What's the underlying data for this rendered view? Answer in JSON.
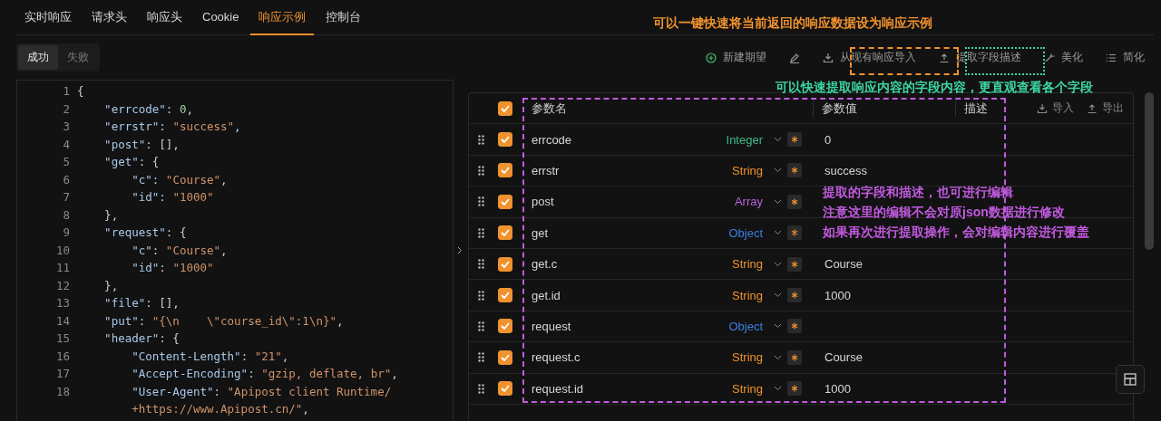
{
  "tabs": [
    {
      "label": "实时响应",
      "selected": false
    },
    {
      "label": "请求头",
      "selected": false
    },
    {
      "label": "响应头",
      "selected": false
    },
    {
      "label": "Cookie",
      "selected": false
    },
    {
      "label": "响应示例",
      "selected": true
    },
    {
      "label": "控制台",
      "selected": false
    }
  ],
  "result_toggle": [
    {
      "label": "成功",
      "selected": true
    },
    {
      "label": "失败",
      "selected": false
    }
  ],
  "toolbar": [
    {
      "kind": "new",
      "label": "新建期望"
    },
    {
      "kind": "edit"
    },
    {
      "kind": "import",
      "label": "从现有响应导入"
    },
    {
      "kind": "extract",
      "label": "提取字段描述"
    },
    {
      "kind": "beautify",
      "label": "美化"
    },
    {
      "kind": "simplify",
      "label": "简化"
    }
  ],
  "editor": {
    "lines": [
      {
        "number": "1",
        "tokens": [
          {
            "kind": "punct",
            "text": "{"
          }
        ]
      },
      {
        "number": "2",
        "tokens": [
          {
            "kind": "key",
            "text": "    \"errcode\""
          },
          {
            "kind": "punct",
            "text": ": "
          },
          {
            "kind": "num",
            "text": "0"
          },
          {
            "kind": "punct",
            "text": ","
          }
        ]
      },
      {
        "number": "3",
        "tokens": [
          {
            "kind": "key",
            "text": "    \"errstr\""
          },
          {
            "kind": "punct",
            "text": ": "
          },
          {
            "kind": "str",
            "text": "\"success\""
          },
          {
            "kind": "punct",
            "text": ","
          }
        ]
      },
      {
        "number": "4",
        "tokens": [
          {
            "kind": "key",
            "text": "    \"post\""
          },
          {
            "kind": "punct",
            "text": ": [],"
          }
        ]
      },
      {
        "number": "5",
        "tokens": [
          {
            "kind": "key",
            "text": "    \"get\""
          },
          {
            "kind": "punct",
            "text": ": {"
          }
        ]
      },
      {
        "number": "6",
        "tokens": [
          {
            "kind": "key",
            "text": "        \"c\""
          },
          {
            "kind": "punct",
            "text": ": "
          },
          {
            "kind": "str",
            "text": "\"Course\""
          },
          {
            "kind": "punct",
            "text": ","
          }
        ]
      },
      {
        "number": "7",
        "tokens": [
          {
            "kind": "key",
            "text": "        \"id\""
          },
          {
            "kind": "punct",
            "text": ": "
          },
          {
            "kind": "str",
            "text": "\"1000\""
          }
        ]
      },
      {
        "number": "8",
        "tokens": [
          {
            "kind": "punct",
            "text": "    },"
          }
        ]
      },
      {
        "number": "9",
        "tokens": [
          {
            "kind": "key",
            "text": "    \"request\""
          },
          {
            "kind": "punct",
            "text": ": {"
          }
        ]
      },
      {
        "number": "10",
        "tokens": [
          {
            "kind": "key",
            "text": "        \"c\""
          },
          {
            "kind": "punct",
            "text": ": "
          },
          {
            "kind": "str",
            "text": "\"Course\""
          },
          {
            "kind": "punct",
            "text": ","
          }
        ]
      },
      {
        "number": "11",
        "tokens": [
          {
            "kind": "key",
            "text": "        \"id\""
          },
          {
            "kind": "punct",
            "text": ": "
          },
          {
            "kind": "str",
            "text": "\"1000\""
          }
        ]
      },
      {
        "number": "12",
        "tokens": [
          {
            "kind": "punct",
            "text": "    },"
          }
        ]
      },
      {
        "number": "13",
        "tokens": [
          {
            "kind": "key",
            "text": "    \"file\""
          },
          {
            "kind": "punct",
            "text": ": [],"
          }
        ]
      },
      {
        "number": "14",
        "tokens": [
          {
            "kind": "key",
            "text": "    \"put\""
          },
          {
            "kind": "punct",
            "text": ": "
          },
          {
            "kind": "str",
            "text": "\"{\\n    \\\"course_id\\\":1\\n}\""
          },
          {
            "kind": "punct",
            "text": ","
          }
        ]
      },
      {
        "number": "15",
        "tokens": [
          {
            "kind": "key",
            "text": "    \"header\""
          },
          {
            "kind": "punct",
            "text": ": {"
          }
        ]
      },
      {
        "number": "16",
        "tokens": [
          {
            "kind": "key",
            "text": "        \"Content-Length\""
          },
          {
            "kind": "punct",
            "text": ": "
          },
          {
            "kind": "str",
            "text": "\"21\""
          },
          {
            "kind": "punct",
            "text": ","
          }
        ]
      },
      {
        "number": "17",
        "tokens": [
          {
            "kind": "key",
            "text": "        \"Accept-Encoding\""
          },
          {
            "kind": "punct",
            "text": ": "
          },
          {
            "kind": "str",
            "text": "\"gzip, deflate, br\""
          },
          {
            "kind": "punct",
            "text": ","
          }
        ]
      },
      {
        "number": "18",
        "tokens": [
          {
            "kind": "key",
            "text": "        \"User-Agent\""
          },
          {
            "kind": "punct",
            "text": ": "
          },
          {
            "kind": "str",
            "text": "\"Apipost client Runtime/"
          }
        ]
      },
      {
        "tokens": [
          {
            "kind": "str",
            "text": "        +https://www.Apipost.cn/\""
          },
          {
            "kind": "punct",
            "text": ","
          }
        ]
      }
    ]
  },
  "table": {
    "all_checked": true,
    "columns": [
      "参数名",
      "参数值",
      "描述"
    ],
    "actions": [
      {
        "kind": "import",
        "label": "导入"
      },
      {
        "kind": "export",
        "label": "导出"
      }
    ],
    "rows": [
      {
        "checked": true,
        "name": "errcode",
        "type": "Integer",
        "color": "#3dbb8a",
        "required": true,
        "value": "0"
      },
      {
        "checked": true,
        "name": "errstr",
        "type": "String",
        "color": "#f0922e",
        "required": true,
        "value": "success"
      },
      {
        "checked": true,
        "name": "post",
        "type": "Array",
        "color": "#b866d8",
        "required": true
      },
      {
        "checked": true,
        "name": "get",
        "type": "Object",
        "color": "#3d7fe0",
        "required": true
      },
      {
        "checked": true,
        "name": "get.c",
        "type": "String",
        "color": "#f0922e",
        "required": true,
        "value": "Course"
      },
      {
        "checked": true,
        "name": "get.id",
        "type": "String",
        "color": "#f0922e",
        "required": true,
        "value": "1000"
      },
      {
        "checked": true,
        "name": "request",
        "type": "Object",
        "color": "#3d7fe0",
        "required": true
      },
      {
        "checked": true,
        "name": "request.c",
        "type": "String",
        "color": "#f0922e",
        "required": true,
        "value": "Course"
      },
      {
        "checked": true,
        "name": "request.id",
        "type": "String",
        "color": "#f0922e",
        "required": true,
        "value": "1000"
      }
    ]
  },
  "annotations": [
    {
      "kind": "top",
      "text": "可以一键快速将当前返回的响应数据设为响应示例",
      "color": "#f0922e"
    },
    {
      "kind": "extract",
      "text": "可以快速提取响应内容的字段内容，更直观查看各个字段",
      "color": "#3dd6a4"
    },
    {
      "kind": "table",
      "lines": [
        "提取的字段和描述，也可进行编辑",
        "注意这里的编辑不会对原json数据进行修改",
        "如果再次进行提取操作，会对编辑内容进行覆盖"
      ],
      "color": "#c25ae0"
    }
  ]
}
